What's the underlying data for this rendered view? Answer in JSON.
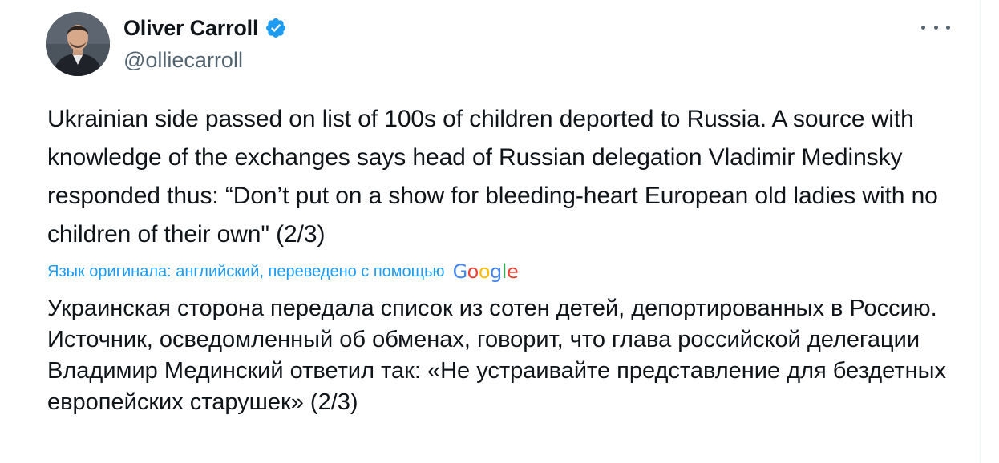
{
  "author": {
    "display_name": "Oliver Carroll",
    "handle": "@olliecarroll",
    "verified": true
  },
  "tweet": {
    "text_original": "Ukrainian side passed on list of 100s of children deported to Russia. A source with knowledge of the exchanges says head of Russian delegation Vladimir Medinsky responded thus: “Don’t put on a show for bleeding-heart European old ladies with no children of their own\" (2/3)",
    "translation_notice": "Язык оригинала: английский, переведено с помощью",
    "translation_provider": "Google",
    "text_translated": "Украинская сторона передала список из сотен детей, депортированных в Россию. Источник, осведомленный об обменах, говорит, что глава российской делегации Владимир Мединский ответил так: «Не устраивайте представление для бездетных европейских старушек» (2/3)"
  },
  "icons": {
    "verified": "verified-badge-icon",
    "more": "more-horizontal-icon"
  },
  "colors": {
    "accent": "#1d9bf0",
    "text_primary": "#0f1419",
    "text_secondary": "#536471"
  }
}
